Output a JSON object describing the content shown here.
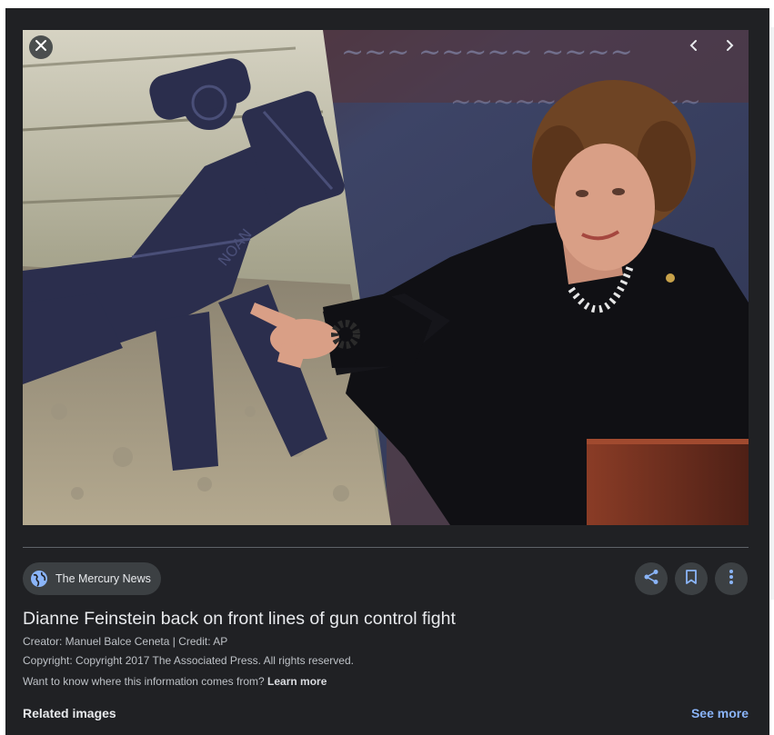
{
  "viewer": {
    "photo": {
      "description_icon": "news-photo",
      "colors": {
        "wall": "#3d4466",
        "wall_text": "#8b93b8",
        "wood": "#c9c6b5",
        "rifle": "#2b2e4d",
        "jacket": "#101014",
        "hair": "#6e4424",
        "skin": "#d99f86",
        "podium": "#6a2f1f"
      }
    },
    "controls": {
      "close_icon": "close-icon",
      "prev_icon": "chevron-left-icon",
      "next_icon": "chevron-right-icon"
    }
  },
  "source": {
    "name": "The Mercury News",
    "icon": "globe-icon"
  },
  "actions": {
    "share_icon": "share-icon",
    "save_icon": "bookmark-icon",
    "more_icon": "more-vert-icon"
  },
  "article": {
    "title": "Dianne Feinstein back on front lines of gun control fight",
    "creator": "Creator: Manuel Balce Ceneta | Credit: AP",
    "copyright": "Copyright: Copyright 2017 The Associated Press. All rights reserved.",
    "info_text": "Want to know where this information comes from?",
    "learn_more": "Learn more"
  },
  "related": {
    "heading": "Related images",
    "see_more": "See more"
  },
  "theme": {
    "panel_bg": "#202124",
    "chip_bg": "#3c4043",
    "accent": "#8ab4f8",
    "text_primary": "#e8eaed",
    "text_secondary": "#bdc1c6"
  }
}
